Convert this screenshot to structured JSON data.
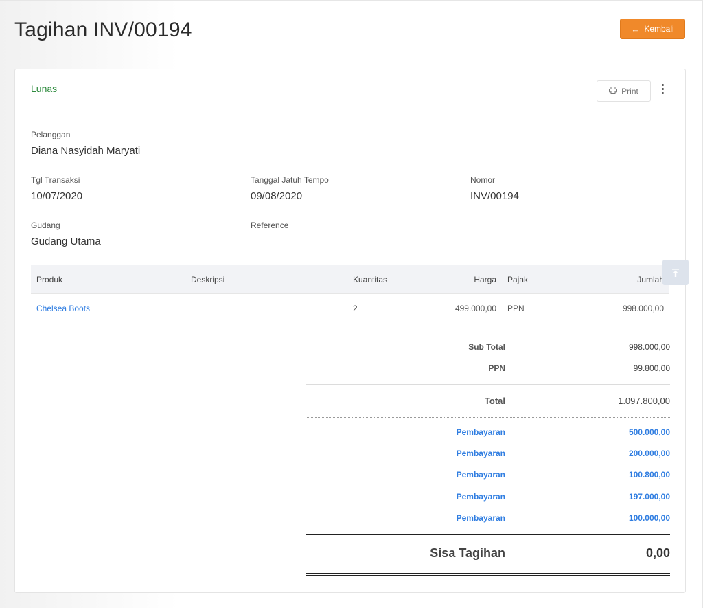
{
  "page": {
    "title": "Tagihan INV/00194",
    "back_label": "Kembali"
  },
  "card": {
    "status": "Lunas",
    "print_label": "Print"
  },
  "details": {
    "customer_label": "Pelanggan",
    "customer_value": "Diana Nasyidah Maryati",
    "date_label": "Tgl Transaksi",
    "date_value": "10/07/2020",
    "due_label": "Tanggal Jatuh Tempo",
    "due_value": "09/08/2020",
    "number_label": "Nomor",
    "number_value": "INV/00194",
    "warehouse_label": "Gudang",
    "warehouse_value": "Gudang Utama",
    "reference_label": "Reference",
    "reference_value": ""
  },
  "table": {
    "headers": {
      "product": "Produk",
      "description": "Deskripsi",
      "quantity": "Kuantitas",
      "price": "Harga",
      "tax": "Pajak",
      "amount": "Jumlah"
    },
    "rows": [
      {
        "product": "Chelsea Boots",
        "description": "",
        "quantity": "2",
        "price": "499.000,00",
        "tax": "PPN",
        "amount": "998.000,00"
      }
    ]
  },
  "totals": {
    "subtotal_label": "Sub Total",
    "subtotal_value": "998.000,00",
    "tax_label": "PPN",
    "tax_value": "99.800,00",
    "total_label": "Total",
    "total_value": "1.097.800,00",
    "payments": [
      {
        "label": "Pembayaran",
        "value": "500.000,00"
      },
      {
        "label": "Pembayaran",
        "value": "200.000,00"
      },
      {
        "label": "Pembayaran",
        "value": "100.800,00"
      },
      {
        "label": "Pembayaran",
        "value": "197.000,00"
      },
      {
        "label": "Pembayaran",
        "value": "100.000,00"
      }
    ],
    "balance_label": "Sisa Tagihan",
    "balance_value": "0,00"
  },
  "colors": {
    "accent": "#f0892a",
    "status": "#2e8b3e",
    "link": "#2f7de1"
  },
  "icons": {
    "back": "arrow-left-icon",
    "print": "printer-icon",
    "more": "kebab-menu-icon",
    "scroll_top": "scroll-to-top-icon"
  }
}
